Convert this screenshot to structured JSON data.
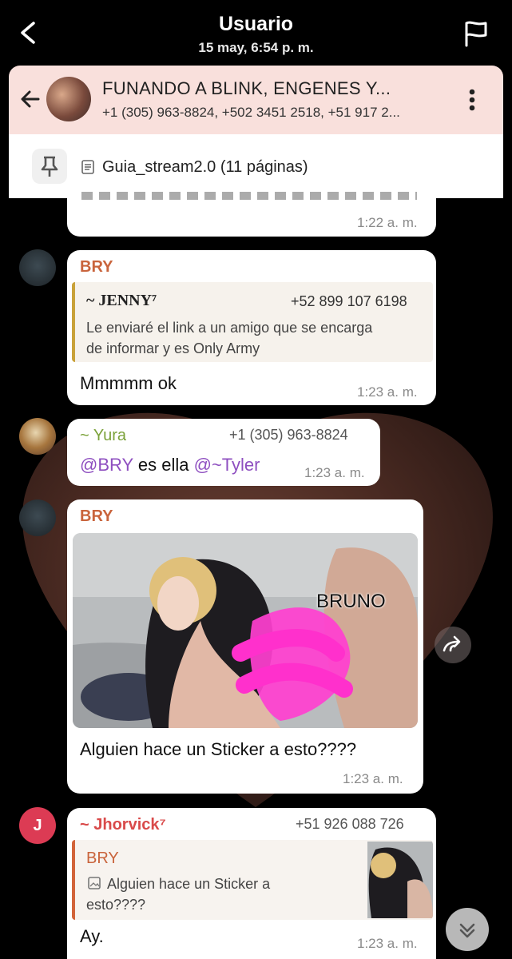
{
  "story": {
    "title": "Usuario",
    "date": "15 may, 6:54 p. m."
  },
  "chat": {
    "title": "FUNANDO A BLINK, ENGENES Y...",
    "members": "+1 (305) 963-8824, +502 3451 2518, +51 917 2...",
    "pinned": "Guia_stream2.0 (11 páginas)"
  },
  "messages": [
    {
      "time": "1:22 a. m."
    },
    {
      "sender": "BRY",
      "reply_name": "~ JENNY⁷",
      "reply_phone": "+52 899 107 6198",
      "reply_text": "Le enviaré el link a un amigo que se encarga de informar y es Only Army",
      "text": "Mmmmm ok",
      "time": "1:23 a. m."
    },
    {
      "sender": "~ Yura",
      "phone": "+1 (305) 963-8824",
      "mention1": "@BRY",
      "middle": " es ella ",
      "mention2": "@~Tyler",
      "time": "1:23 a. m."
    },
    {
      "sender": "BRY",
      "image_caption": "BRUNO",
      "text": "Alguien hace un Sticker a esto????",
      "time": "1:23 a. m."
    },
    {
      "avatar_letter": "J",
      "sender": "~ Jhorvick⁷",
      "phone": "+51 926 088 726",
      "reply_name": "BRY",
      "reply_text": "Alguien hace un Sticker a esto????",
      "text": "Ay.",
      "time": "1:23 a. m."
    }
  ],
  "colors": {
    "bry": "#c9643c",
    "yura": "#7ba23a",
    "jhorvick": "#d94a4a",
    "mention": "#8e4fc0",
    "jenny_bar": "#c9a23a"
  }
}
